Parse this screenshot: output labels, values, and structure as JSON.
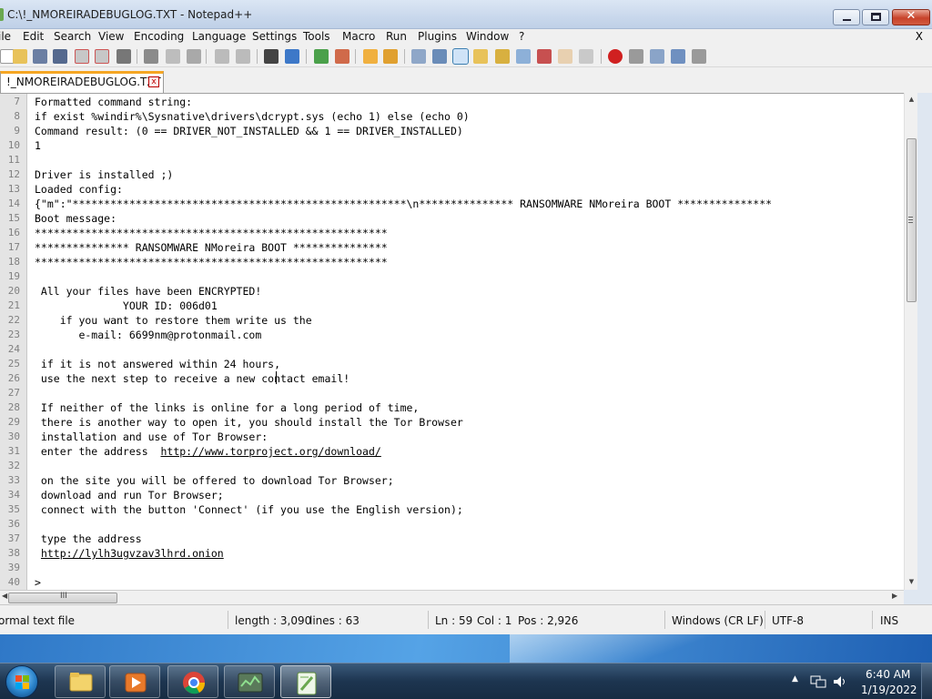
{
  "window": {
    "title": "C:\\!_NMOREIRADEBUGLOG.TXT - Notepad++",
    "close_glyph": "✕"
  },
  "menu": {
    "items": [
      "ile",
      "Edit",
      "Search",
      "View",
      "Encoding",
      "Language",
      "Settings",
      "Tools",
      "Macro",
      "Run",
      "Plugins",
      "Window",
      "?"
    ],
    "close_doc": "X"
  },
  "tab": {
    "label": "!_NMOREIRADEBUGLOG.TXT",
    "close_glyph": "x"
  },
  "editor": {
    "lines": [
      {
        "n": "7",
        "text": "Formatted command string:"
      },
      {
        "n": "8",
        "text": "if exist %windir%\\Sysnative\\drivers\\dcrypt.sys (echo 1) else (echo 0)"
      },
      {
        "n": "9",
        "text": "Command result: (0 == DRIVER_NOT_INSTALLED && 1 == DRIVER_INSTALLED)"
      },
      {
        "n": "10",
        "text": "1"
      },
      {
        "n": "11",
        "text": ""
      },
      {
        "n": "12",
        "text": "Driver is installed ;)"
      },
      {
        "n": "13",
        "text": "Loaded config:"
      },
      {
        "n": "14",
        "text": "{\"m\":\"*****************************************************\\n*************** RANSOMWARE NMoreira BOOT ***************"
      },
      {
        "n": "15",
        "text": "Boot message:"
      },
      {
        "n": "16",
        "text": "********************************************************"
      },
      {
        "n": "17",
        "text": "*************** RANSOMWARE NMoreira BOOT ***************"
      },
      {
        "n": "18",
        "text": "********************************************************"
      },
      {
        "n": "19",
        "text": ""
      },
      {
        "n": "20",
        "text": " All your files have been ENCRYPTED!"
      },
      {
        "n": "21",
        "text": "              YOUR ID: 006d01"
      },
      {
        "n": "22",
        "text": "    if you want to restore them write us the"
      },
      {
        "n": "23",
        "text": "       e-mail: 6699nm@protonmail.com"
      },
      {
        "n": "24",
        "text": ""
      },
      {
        "n": "25",
        "text": " if it is not answered within 24 hours,"
      },
      {
        "n": "26",
        "text": " use the next step to receive a new contact email!"
      },
      {
        "n": "27",
        "text": ""
      },
      {
        "n": "28",
        "text": " If neither of the links is online for a long period of time,"
      },
      {
        "n": "29",
        "text": " there is another way to open it, you should install the Tor Browser"
      },
      {
        "n": "30",
        "text": " installation and use of Tor Browser:"
      },
      {
        "n": "31",
        "text": " enter the address  http://www.torproject.org/download/"
      },
      {
        "n": "32",
        "text": ""
      },
      {
        "n": "33",
        "text": " on the site you will be offered to download Tor Browser;"
      },
      {
        "n": "34",
        "text": " download and run Tor Browser;"
      },
      {
        "n": "35",
        "text": " connect with the button 'Connect' (if you use the English version);"
      },
      {
        "n": "36",
        "text": ""
      },
      {
        "n": "37",
        "text": " type the address"
      },
      {
        "n": "38",
        "text": " http://lylh3ugvzav3lhrd.onion"
      },
      {
        "n": "39",
        "text": ""
      },
      {
        "n": "40",
        "text": ">"
      }
    ]
  },
  "hscroll": {
    "grip": "III"
  },
  "status": {
    "file_type": "ormal text file",
    "length": "length : 3,090",
    "lines": "lines : 63",
    "ln": "Ln : 59",
    "col": "Col : 1",
    "pos": "Pos : 2,926",
    "eol": "Windows (CR LF)",
    "encoding": "UTF-8",
    "mode": "INS"
  },
  "taskbar": {
    "time": "6:40 AM",
    "date": "1/19/2022",
    "tray_arrow": "▲"
  },
  "colors": {
    "tab_accent": "#f5a623",
    "line_number": "#808080",
    "close_button": "#c8432a"
  }
}
